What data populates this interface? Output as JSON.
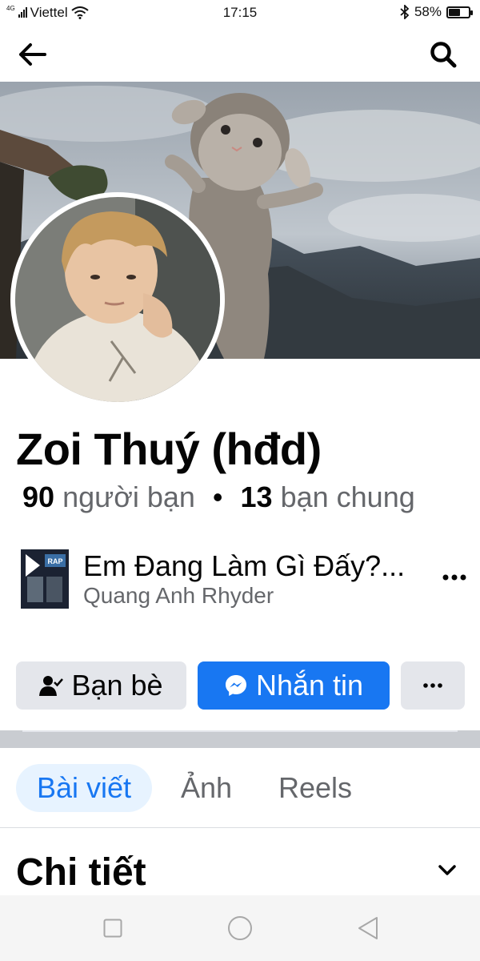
{
  "status_bar": {
    "network": "4G",
    "carrier": "Viettel",
    "time": "17:15",
    "battery_percent": "58%",
    "battery_level": 0.58
  },
  "top_nav": {
    "back_icon": "arrow-left-icon",
    "search_icon": "search-icon"
  },
  "profile": {
    "name": "Zoi Thuý (hđd)",
    "friends_count": "90",
    "friends_label": "người bạn",
    "separator": "•",
    "mutual_count": "13",
    "mutual_label": "bạn chung"
  },
  "music": {
    "title": "Em Đang Làm Gì Đấy?...",
    "artist": "Quang Anh Rhyder",
    "art_text": "RAP",
    "more_icon": "more-dots-icon"
  },
  "actions": {
    "friends_label": "Bạn bè",
    "message_label": "Nhắn tin",
    "friends_icon": "friend-check-icon",
    "message_icon": "messenger-icon",
    "more_icon": "more-dots-icon"
  },
  "tabs": [
    {
      "label": "Bài viết",
      "active": true
    },
    {
      "label": "Ảnh",
      "active": false
    },
    {
      "label": "Reels",
      "active": false
    }
  ],
  "details": {
    "title": "Chi tiết"
  },
  "colors": {
    "accent": "#1877f2",
    "secondary_button": "#e4e6eb",
    "tab_active_bg": "#e7f3ff",
    "muted_text": "#65676b"
  }
}
